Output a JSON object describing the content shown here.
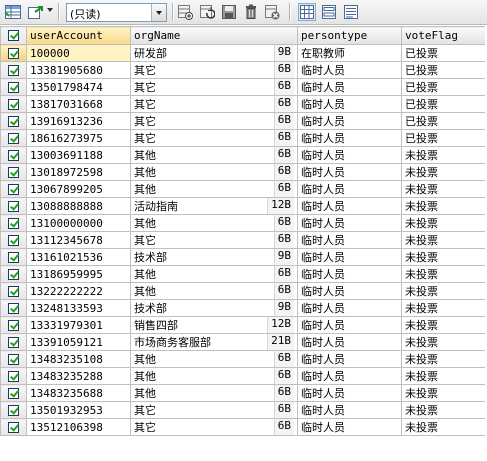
{
  "toolbar": {
    "mode_value": "(只读)",
    "icons_left": [
      "grid-icon",
      "export-icon"
    ],
    "icons_mid": [
      "add-row-icon",
      "refresh-icon",
      "save-icon",
      "delete-icon",
      "cancel-icon"
    ],
    "icons_view": [
      "grid-view-icon",
      "form-view-icon",
      "text-view-icon"
    ]
  },
  "table": {
    "columns": [
      "userAccount",
      "orgName",
      "persontype",
      "voteFlag"
    ],
    "rows": [
      {
        "account": "100000",
        "org": "研发部",
        "size": "9B",
        "type": "在职教师",
        "vote": "已投票"
      },
      {
        "account": "13381905680",
        "org": "其它",
        "size": "6B",
        "type": "临时人员",
        "vote": "已投票"
      },
      {
        "account": "13501798474",
        "org": "其它",
        "size": "6B",
        "type": "临时人员",
        "vote": "已投票"
      },
      {
        "account": "13817031668",
        "org": "其它",
        "size": "6B",
        "type": "临时人员",
        "vote": "已投票"
      },
      {
        "account": "13916913236",
        "org": "其它",
        "size": "6B",
        "type": "临时人员",
        "vote": "已投票"
      },
      {
        "account": "18616273975",
        "org": "其它",
        "size": "6B",
        "type": "临时人员",
        "vote": "已投票"
      },
      {
        "account": "13003691188",
        "org": "其他",
        "size": "6B",
        "type": "临时人员",
        "vote": "未投票"
      },
      {
        "account": "13018972598",
        "org": "其他",
        "size": "6B",
        "type": "临时人员",
        "vote": "未投票"
      },
      {
        "account": "13067899205",
        "org": "其他",
        "size": "6B",
        "type": "临时人员",
        "vote": "未投票"
      },
      {
        "account": "13088888888",
        "org": "活动指南",
        "size": "12B",
        "type": "临时人员",
        "vote": "未投票"
      },
      {
        "account": "13100000000",
        "org": "其他",
        "size": "6B",
        "type": "临时人员",
        "vote": "未投票"
      },
      {
        "account": "13112345678",
        "org": "其它",
        "size": "6B",
        "type": "临时人员",
        "vote": "未投票"
      },
      {
        "account": "13161021536",
        "org": "技术部",
        "size": "9B",
        "type": "临时人员",
        "vote": "未投票"
      },
      {
        "account": "13186959995",
        "org": "其他",
        "size": "6B",
        "type": "临时人员",
        "vote": "未投票"
      },
      {
        "account": "13222222222",
        "org": "其他",
        "size": "6B",
        "type": "临时人员",
        "vote": "未投票"
      },
      {
        "account": "13248133593",
        "org": "技术部",
        "size": "9B",
        "type": "临时人员",
        "vote": "未投票"
      },
      {
        "account": "13331979301",
        "org": "销售四部",
        "size": "12B",
        "type": "临时人员",
        "vote": "未投票"
      },
      {
        "account": "13391059121",
        "org": "市场商务客服部",
        "size": "21B",
        "type": "临时人员",
        "vote": "未投票"
      },
      {
        "account": "13483235108",
        "org": "其他",
        "size": "6B",
        "type": "临时人员",
        "vote": "未投票"
      },
      {
        "account": "13483235288",
        "org": "其他",
        "size": "6B",
        "type": "临时人员",
        "vote": "未投票"
      },
      {
        "account": "13483235688",
        "org": "其他",
        "size": "6B",
        "type": "临时人员",
        "vote": "未投票"
      },
      {
        "account": "13501932953",
        "org": "其它",
        "size": "6B",
        "type": "临时人员",
        "vote": "未投票"
      },
      {
        "account": "13512106398",
        "org": "其它",
        "size": "6B",
        "type": "临时人员",
        "vote": "未投票"
      }
    ]
  },
  "colors": {
    "check": "#21a121",
    "header_selected": "#f9d98a",
    "grid_line": "#c0c0c0"
  }
}
